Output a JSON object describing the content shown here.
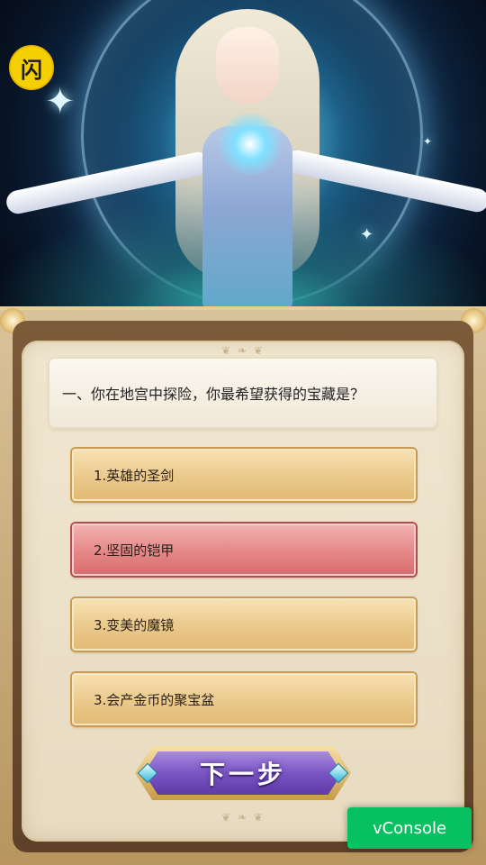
{
  "app": {
    "logo_glyph": "闪",
    "accent": "#f4d000"
  },
  "quiz": {
    "question": "一、你在地宫中探险，你最希望获得的宝藏是？",
    "options": [
      {
        "label": "1.英雄的圣剑",
        "selected": false
      },
      {
        "label": "2.坚固的铠甲",
        "selected": true
      },
      {
        "label": "3.变美的魔镜",
        "selected": false
      },
      {
        "label": "3.会产金币的聚宝盆",
        "selected": false
      }
    ],
    "next_label": "下一步",
    "selected_color": "#e58787",
    "option_color": "#eac98b",
    "button_color": "#7a55c4"
  },
  "vconsole": {
    "label": "vConsole",
    "color": "#07c160"
  }
}
